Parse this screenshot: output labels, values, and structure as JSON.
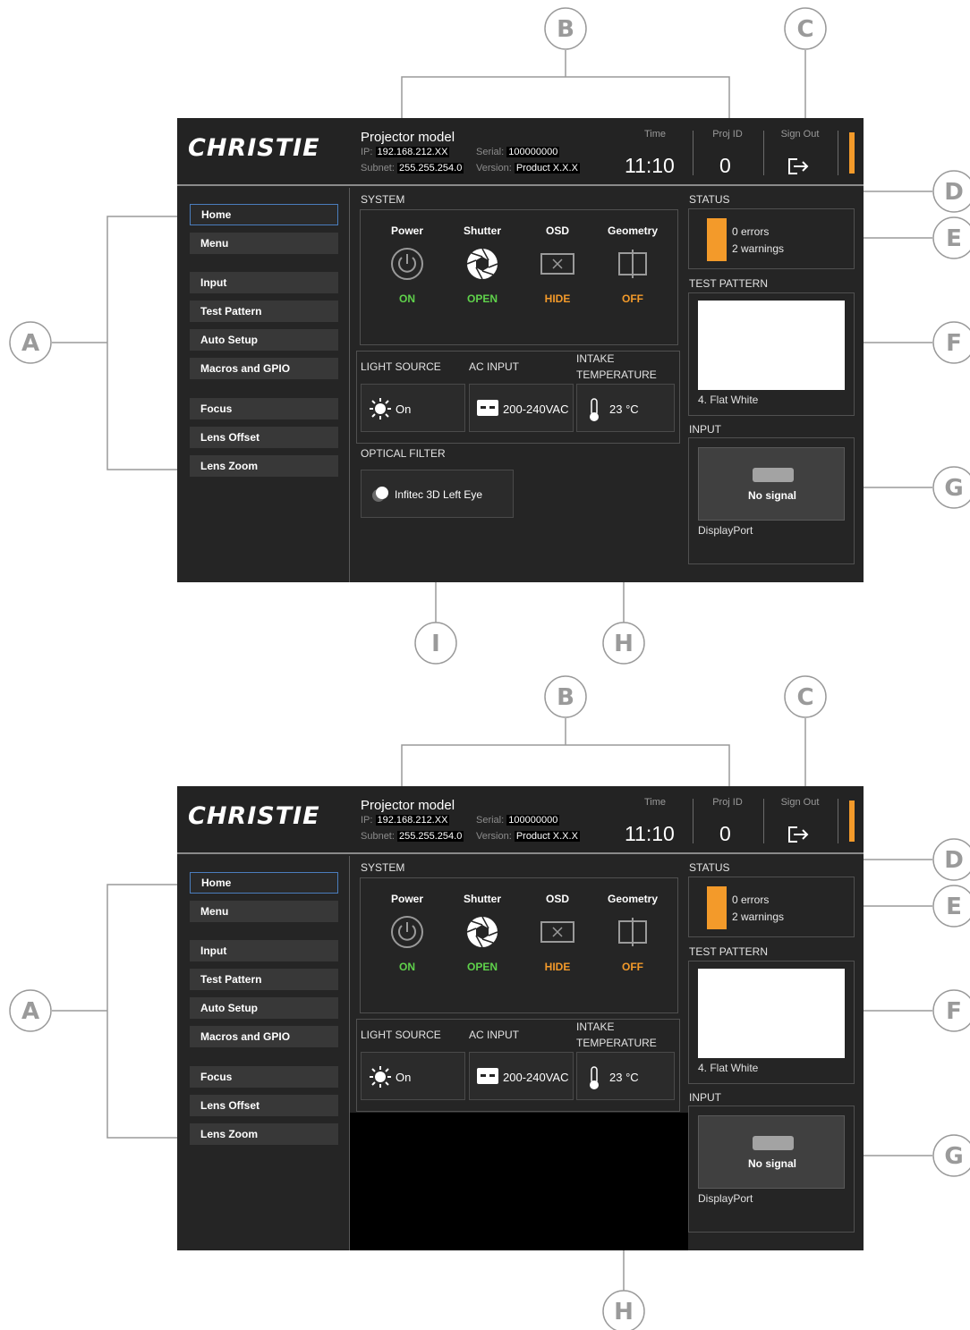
{
  "callouts": [
    "A",
    "B",
    "C",
    "D",
    "E",
    "F",
    "G",
    "H",
    "I"
  ],
  "header": {
    "brand": "CHRISTIE",
    "model": "Projector model",
    "ip_label": "IP:",
    "ip": "192.168.212.XX",
    "subnet_label": "Subnet:",
    "subnet": "255.255.254.0",
    "serial_label": "Serial:",
    "serial": "100000000",
    "version_label": "Version:",
    "version": "Product X.X.X",
    "time_label": "Time",
    "time": "11:10",
    "projid_label": "Proj ID",
    "projid": "0",
    "signout_label": "Sign Out",
    "status_color": "#f39a2a"
  },
  "sidebar": {
    "items": [
      {
        "label": "Home",
        "active": true
      },
      {
        "label": "Menu"
      },
      {
        "label": "Input"
      },
      {
        "label": "Test Pattern"
      },
      {
        "label": "Auto Setup"
      },
      {
        "label": "Macros and GPIO"
      },
      {
        "label": "Focus"
      },
      {
        "label": "Lens Offset"
      },
      {
        "label": "Lens Zoom"
      }
    ]
  },
  "system": {
    "title": "SYSTEM",
    "power": {
      "label": "Power",
      "state": "ON",
      "icon": "power-icon",
      "color": "#5fd24b"
    },
    "shutter": {
      "label": "Shutter",
      "state": "OPEN",
      "icon": "shutter-icon",
      "color": "#5fd24b"
    },
    "osd": {
      "label": "OSD",
      "state": "HIDE",
      "icon": "osd-hidden-icon",
      "color": "#f39a2a"
    },
    "geometry": {
      "label": "Geometry",
      "state": "OFF",
      "icon": "geometry-icon",
      "color": "#f39a2a"
    }
  },
  "light_source": {
    "title": "LIGHT SOURCE",
    "value": "On",
    "icon": "sun-icon"
  },
  "ac_input": {
    "title": "AC INPUT",
    "value": "200-240VAC",
    "icon": "plug-icon"
  },
  "intake_temperature": {
    "title_line1": "INTAKE",
    "title_line2": "TEMPERATURE",
    "value": "23 °C",
    "icon": "thermometer-icon"
  },
  "optical_filter": {
    "title": "OPTICAL FILTER",
    "value": "Infitec 3D Left Eye",
    "icon": "filter-icon"
  },
  "status": {
    "title": "STATUS",
    "errors": "0 errors",
    "warnings": "2 warnings"
  },
  "test_pattern": {
    "title": "TEST PATTERN",
    "name": "4. Flat White"
  },
  "input": {
    "title": "INPUT",
    "signal": "No signal",
    "name": "DisplayPort",
    "icon": "displayport-icon"
  }
}
